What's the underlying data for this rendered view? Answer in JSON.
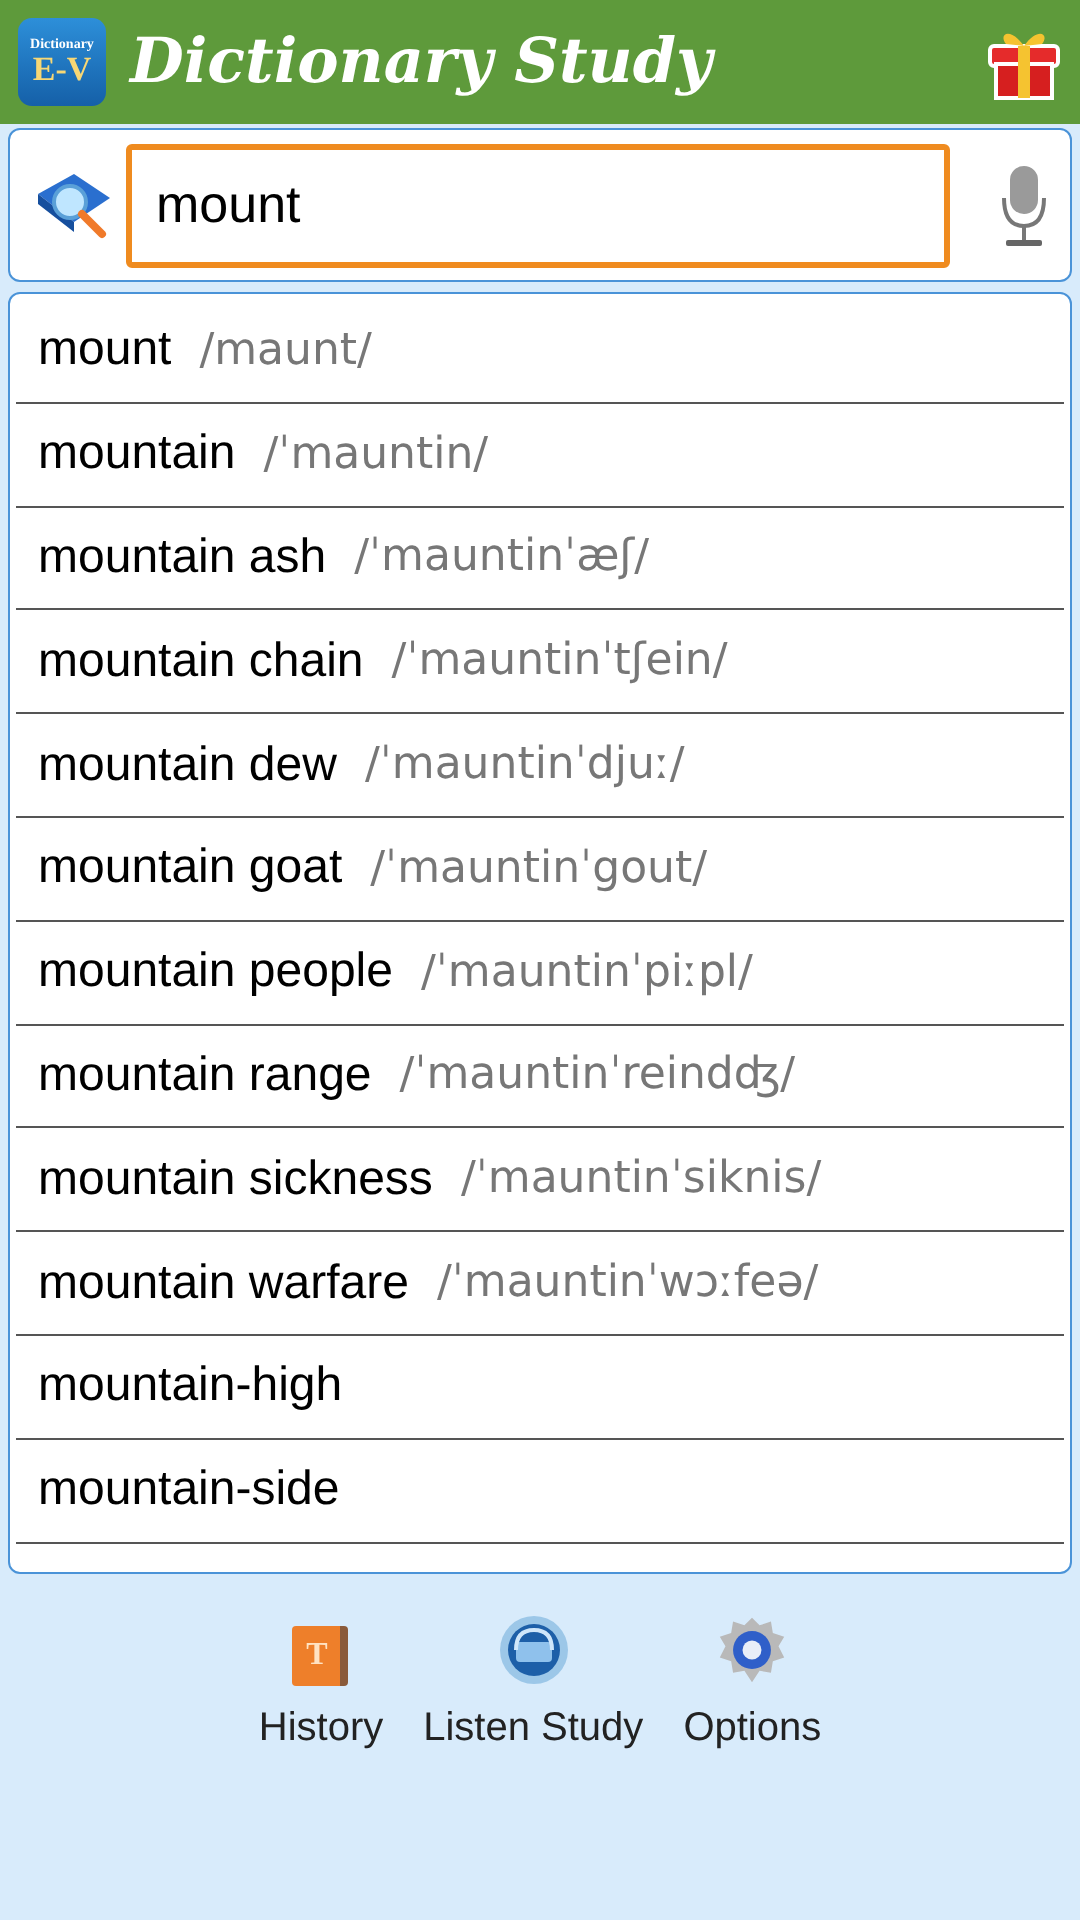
{
  "app_bar": {
    "logo": {
      "top_text": "Dictionary",
      "main_text": "E-V"
    },
    "title": "Dictionary Study"
  },
  "search": {
    "value": "mount"
  },
  "results": [
    {
      "word": "mount",
      "pronunciation": "/maunt/"
    },
    {
      "word": "mountain",
      "pronunciation": "/ˈmauntin/"
    },
    {
      "word": "mountain ash",
      "pronunciation": "/ˈmauntinˈæʃ/"
    },
    {
      "word": "mountain chain",
      "pronunciation": "/ˈmauntinˈtʃein/"
    },
    {
      "word": "mountain dew",
      "pronunciation": "/ˈmauntinˈdjuː/"
    },
    {
      "word": "mountain goat",
      "pronunciation": "/ˈmauntinˈgout/"
    },
    {
      "word": "mountain people",
      "pronunciation": "/ˈmauntinˈpiːpl/"
    },
    {
      "word": "mountain range",
      "pronunciation": "/ˈmauntinˈreindʤ/"
    },
    {
      "word": "mountain sickness",
      "pronunciation": "/ˈmauntinˈsiknis/"
    },
    {
      "word": "mountain warfare",
      "pronunciation": "/ˈmauntinˈwɔːfeə/"
    },
    {
      "word": "mountain-high"
    },
    {
      "word": "mountain-side"
    }
  ],
  "bottom_nav": [
    {
      "kind": "history",
      "label": "History",
      "icon_letter": "T"
    },
    {
      "kind": "listen",
      "label": "Listen Study"
    },
    {
      "kind": "options",
      "label": "Options"
    }
  ]
}
